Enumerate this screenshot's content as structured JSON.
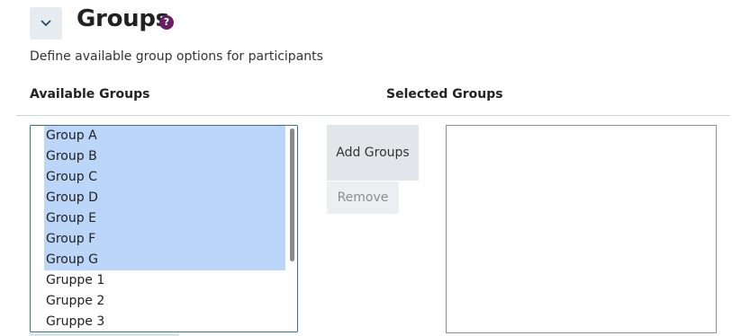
{
  "section": {
    "title": "Groups",
    "help_glyph": "?",
    "description": "Define available group options for participants"
  },
  "columns": {
    "available_label": "Available Groups",
    "selected_label": "Selected Groups"
  },
  "available_groups": [
    {
      "label": "Group A",
      "selected": true
    },
    {
      "label": "Group B",
      "selected": true
    },
    {
      "label": "Group C",
      "selected": true
    },
    {
      "label": "Group D",
      "selected": true
    },
    {
      "label": "Group E",
      "selected": true
    },
    {
      "label": "Group F",
      "selected": true
    },
    {
      "label": "Group G",
      "selected": true
    },
    {
      "label": "Gruppe 1",
      "selected": false
    },
    {
      "label": "Gruppe 2",
      "selected": false
    },
    {
      "label": "Gruppe 3",
      "selected": false
    }
  ],
  "selected_groups": [],
  "buttons": {
    "add_label": "Add Groups",
    "remove_label": "Remove"
  },
  "icons": {
    "collapse": "chevron-down-icon",
    "help": "help-icon"
  },
  "colors": {
    "accent": "#2f6db5",
    "selection": "#bcd6fa",
    "help": "#6b1f63"
  }
}
